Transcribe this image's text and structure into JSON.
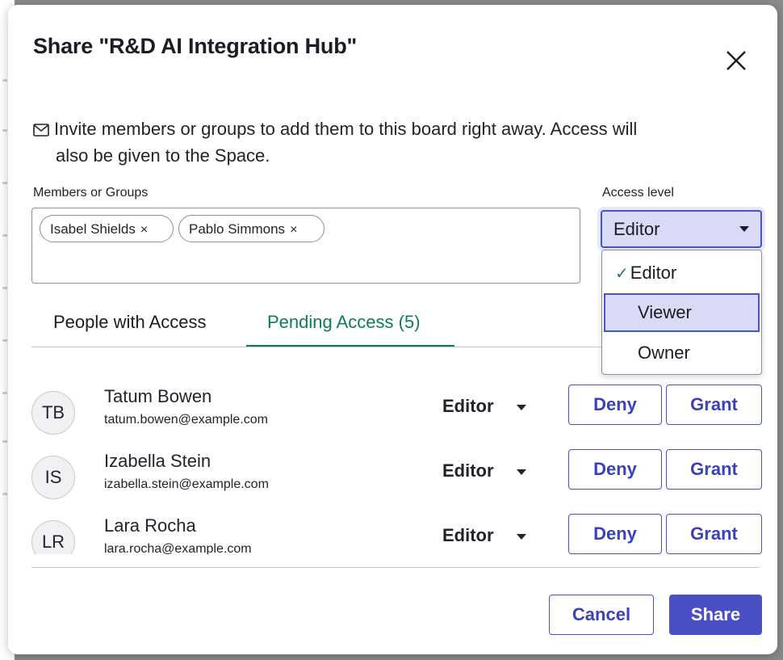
{
  "dialog": {
    "title": "Share \"R&D AI Integration Hub\"",
    "info_line1": "Invite members or groups to add them to this board right away. Access will",
    "info_line2": "also be given to the Space."
  },
  "members": {
    "label": "Members or Groups",
    "chips": [
      "Isabel Shields",
      "Pablo Simmons"
    ],
    "remove_glyph": "×"
  },
  "access": {
    "label": "Access level",
    "selected": "Editor",
    "options": [
      "Editor",
      "Viewer",
      "Owner"
    ],
    "hovered": "Viewer"
  },
  "tabs": {
    "people": "People with Access",
    "pending": "Pending Access (5)"
  },
  "pending": [
    {
      "initials": "TB",
      "name": "Tatum Bowen",
      "email": "tatum.bowen@example.com",
      "role": "Editor"
    },
    {
      "initials": "IS",
      "name": "Izabella Stein",
      "email": "izabella.stein@example.com",
      "role": "Editor"
    },
    {
      "initials": "LR",
      "name": "Lara Rocha",
      "email": "lara.rocha@example.com",
      "role": "Editor"
    }
  ],
  "row_actions": {
    "deny": "Deny",
    "grant": "Grant"
  },
  "footer": {
    "cancel": "Cancel",
    "share": "Share"
  },
  "colors": {
    "accent": "#4a4fc4",
    "active_tab": "#0e7d57"
  },
  "icons": {
    "close": "close-icon",
    "mail": "mail-icon",
    "check": "check-icon",
    "caret": "caret-down-icon"
  }
}
